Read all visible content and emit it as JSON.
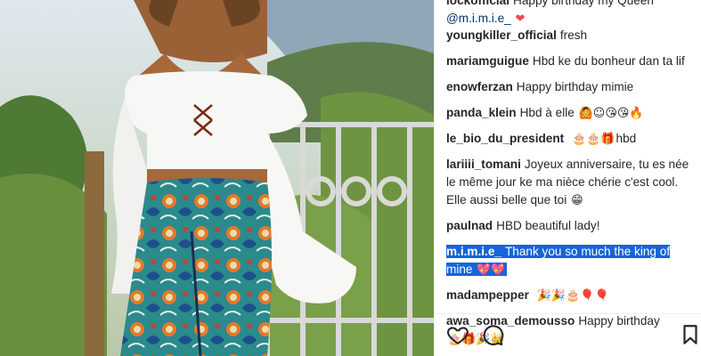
{
  "photo": {
    "alt": ""
  },
  "first_comment": {
    "user": "lockofficial",
    "text": "Happy birthday my Queen",
    "mention": "@m.i.m.i.e_",
    "emoji": "❤"
  },
  "comments": [
    {
      "user": "youngkiller_official",
      "text": "fresh",
      "emoji": ""
    },
    {
      "user": "mariamguigue",
      "text": "Hbd ke du bonheur dan ta lif",
      "emoji": ""
    },
    {
      "user": "enowferzan",
      "text": "Happy birthday mimie",
      "emoji": ""
    },
    {
      "user": "panda_klein",
      "text": "Hbd à elle",
      "emoji": "🙆☺😘😘🔥"
    },
    {
      "user": "le_bio_du_president",
      "text": "",
      "emoji": "🎂🎂🎁",
      "tail": "hbd"
    },
    {
      "user": "lariiii_tomani",
      "text": "Joyeux anniversaire, tu es née le même jour ke ma nièce chérie c'est cool. Elle aussi belle que toi",
      "emoji": "😁"
    },
    {
      "user": "paulnad",
      "text": "HBD beautiful lady!",
      "emoji": ""
    },
    {
      "user": "m.i.m.i.e_",
      "text": "Thank you so much the king of mine",
      "emoji": "💖💖",
      "selected": true
    },
    {
      "user": "madampepper",
      "text": "",
      "emoji": "🎉🎉🎂🎈🎈"
    },
    {
      "user": "awa_soma_demousso",
      "text": "Happy birthday",
      "emoji": "🎂🎁🎉👑"
    }
  ],
  "actions": {
    "like": "heart-icon",
    "comment": "comment-icon",
    "save": "bookmark-icon"
  },
  "colors": {
    "selection": "#1565d8",
    "heart": "#ed4956",
    "text": "#262626"
  }
}
